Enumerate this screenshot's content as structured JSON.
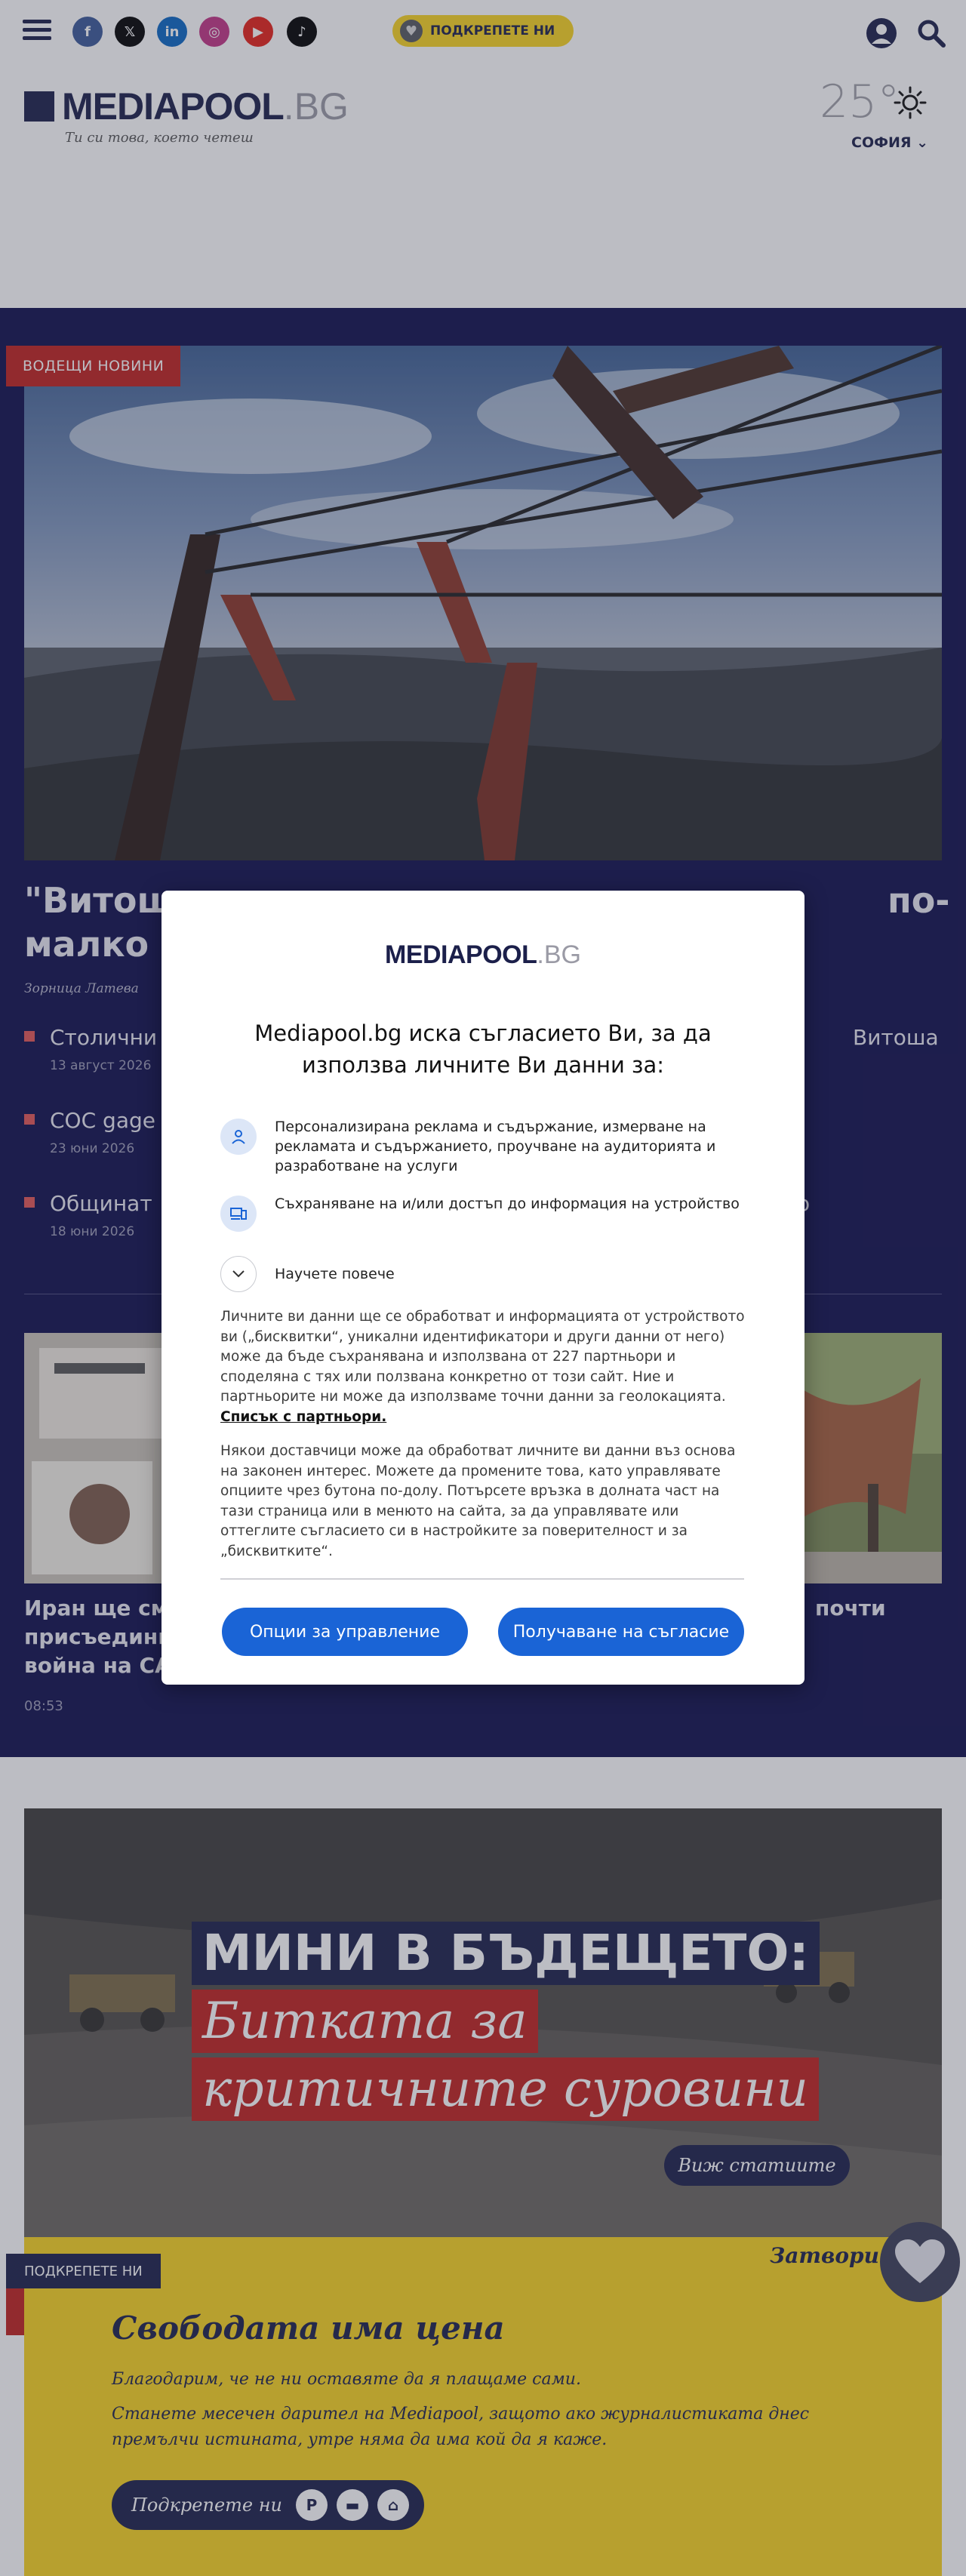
{
  "topbar": {
    "social": [
      {
        "icon": "facebook-icon",
        "glyph": "f",
        "color": "#3b5998"
      },
      {
        "icon": "x-icon",
        "glyph": "𝕏",
        "color": "#000000"
      },
      {
        "icon": "linkedin-icon",
        "glyph": "in",
        "color": "#0a66c2"
      },
      {
        "icon": "instagram-icon",
        "glyph": "◎",
        "color": "#c13584"
      },
      {
        "icon": "youtube-icon",
        "glyph": "▶",
        "color": "#e62117"
      },
      {
        "icon": "tiktok-icon",
        "glyph": "♪",
        "color": "#000000"
      }
    ],
    "support_label": "ПОДКРЕПЕТЕ НИ"
  },
  "header": {
    "logo_name": "MEDIAPOOL",
    "logo_tld": ".BG",
    "tagline": "Ти си това, което четеш",
    "temperature": "25°",
    "city": "СОФИЯ"
  },
  "lead": {
    "badge": "ВОДЕЩИ НОВИНИ",
    "title": "\"Витошка\" … по-малко",
    "title_left": "\"Витош",
    "title_right": "по-",
    "title_line2": "малко",
    "author": "Зорница Латева",
    "related": [
      {
        "title": "Столични",
        "date": "13 август 2026",
        "right": "Витоша"
      },
      {
        "title": "СОС gage",
        "date": "23 юни 2026",
        "right": ""
      },
      {
        "title": "Общинат",
        "date": "18 юни 2026",
        "right": "о"
      }
    ]
  },
  "cards": [
    {
      "title_lines": [
        "Иран ще смя",
        "присъединил",
        "война на СА"
      ],
      "time": "08:53"
    },
    {
      "title_lines": [
        "почти"
      ],
      "time": ""
    }
  ],
  "banner": {
    "line1": "МИНИ В БЪДЕЩЕТО:",
    "line2": "Битката за",
    "line3": "критичните суровини",
    "button": "Виж статиите"
  },
  "support": {
    "badge": "ПОДКРЕПЕТЕ НИ",
    "close": "Затвори",
    "title": "Свободата има цена",
    "p1": "Благодарим, че не ни оставяте да я плащаме сами.",
    "p2": "Станете месечен дарител на Mediapool, защото ако журналистиката днес премълчи истината, утре няма да има кой да я каже.",
    "button": "Подкрепете ни"
  },
  "consent": {
    "logo_name": "MEDIAPOOL",
    "logo_tld": ".BG",
    "heading": "Mediapool.bg иска съгласието Ви, за да използва личните Ви данни за:",
    "purpose1": "Персонализирана реклама и съдържание, измерване на рекламата и съдържанието, проучване на аудиторията и разработване на услуги",
    "purpose2": "Съхраняване на и/или достъп до информация на устройство",
    "learn_more": "Научете повече",
    "body1": "Личните ви данни ще се обработват и информацията от устройството ви („бисквитки“, уникални идентификатори и други данни от него) може да бъде съхранявана и използвана от 227 партньори и споделяна с тях или ползвана конкретно от този сайт. Ние и партньорите ни може да използваме точни данни за геолокацията.",
    "partners_link": "Списък с партньори.",
    "body2": "Някои доставчици може да обработват личните ви данни въз основа на законен интерес. Можете да промените това, като управлявате опциите чрез бутона по-долу. Потърсете връзка в долната част на тази страница или в менюто на сайта, за да управлявате или оттеглите съгласието си в настройките за поверителност и за „бисквитките“.",
    "manage_button": "Опции за управление",
    "accept_button": "Получаване на съгласие"
  }
}
